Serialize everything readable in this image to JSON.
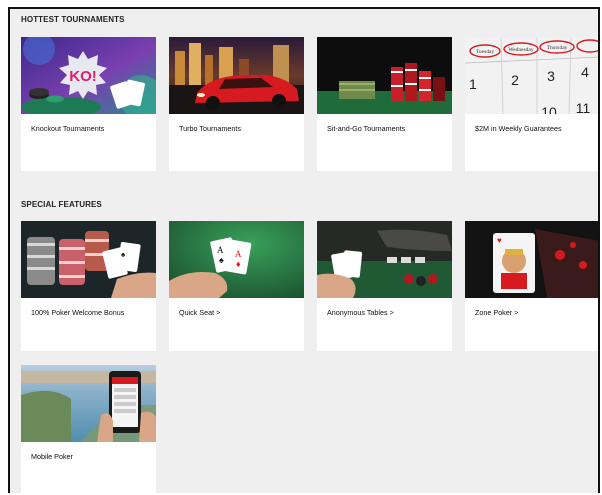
{
  "sections": [
    {
      "title": "HOTTEST TOURNAMENTS",
      "cards": [
        {
          "label": "Knockout Tournaments",
          "badge": "KO!"
        },
        {
          "label": "Turbo Tournaments"
        },
        {
          "label": "Sit-and-Go Tournaments"
        },
        {
          "label": "$2M in Weekly Guarantees",
          "calendar": {
            "days": [
              "Tuesday",
              "Wednesday",
              "Thursday"
            ],
            "dates": [
              "2",
              "3",
              "4",
              "10",
              "11"
            ]
          }
        }
      ]
    },
    {
      "title": "SPECIAL FEATURES",
      "cards": [
        {
          "label": "100% Poker Welcome Bonus"
        },
        {
          "label": "Quick Seat >"
        },
        {
          "label": "Anonymous Tables >"
        },
        {
          "label": "Zone Poker >"
        },
        {
          "label": "Mobile Poker"
        }
      ]
    }
  ],
  "colors": {
    "background": "#efefef",
    "card": "#ffffff",
    "text": "#111111",
    "felt_green": "#1f6b3a",
    "red": "#d71920"
  }
}
